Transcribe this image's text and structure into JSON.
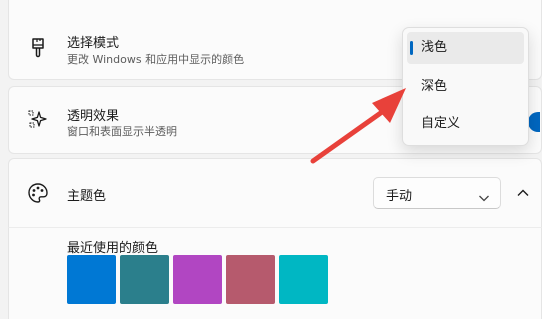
{
  "settings": {
    "mode": {
      "title": "选择模式",
      "subtitle": "更改 Windows 和应用中显示的颜色",
      "icon": "paintbrush-icon"
    },
    "transparency": {
      "title": "透明效果",
      "subtitle": "窗口和表面显示半透明",
      "icon": "sparkle-icon",
      "toggle_on": true
    },
    "accent": {
      "title": "主题色",
      "icon": "palette-icon",
      "dropdown_value": "手动",
      "recent_label": "最近使用的颜色",
      "recent_colors": [
        "#0078d4",
        "#2b7f8c",
        "#b146c2",
        "#b65a6d",
        "#00b7c3"
      ]
    }
  },
  "mode_menu": {
    "options": [
      "浅色",
      "深色",
      "自定义"
    ],
    "selected_index": 0
  },
  "colors": {
    "accent": "#0067c0",
    "arrow": "#e8413a"
  }
}
